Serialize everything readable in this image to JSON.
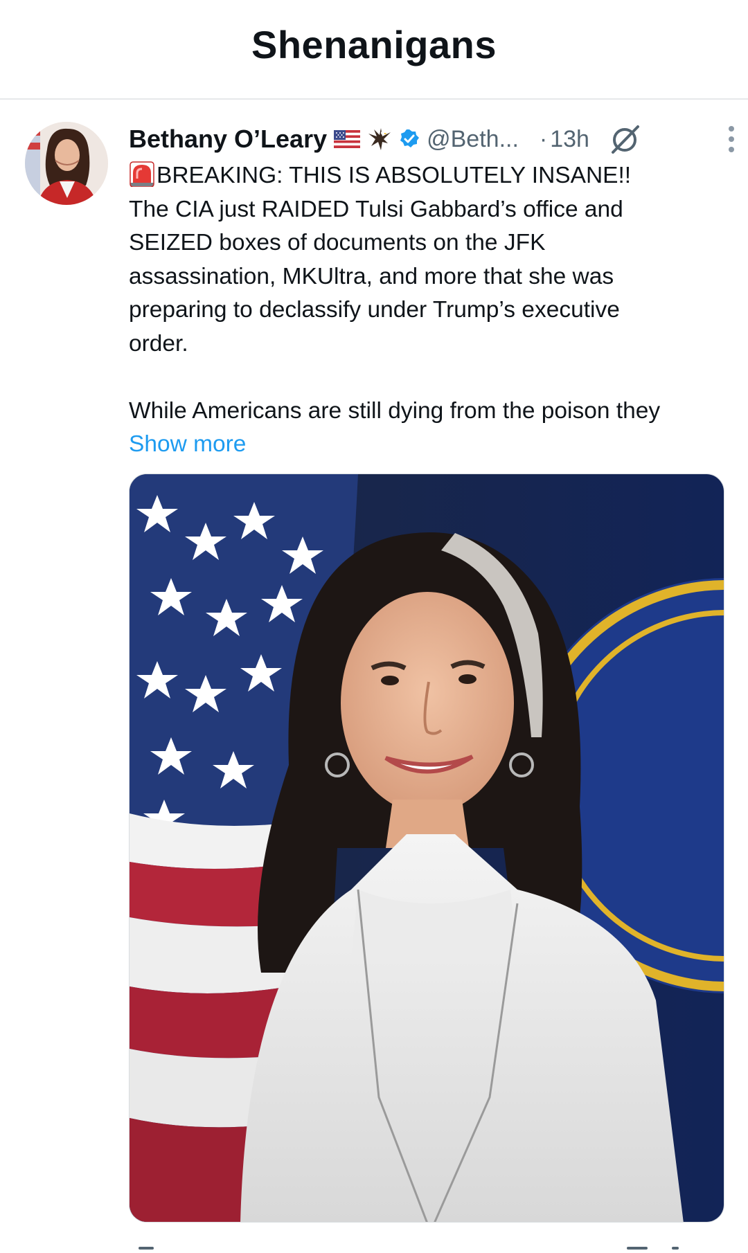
{
  "header": {
    "title": "Shenanigans"
  },
  "tweet": {
    "author": {
      "display_name": "Bethany O’Leary",
      "handle": "@Beth...",
      "verified": true,
      "emoji": [
        "flag-us-icon",
        "eagle-icon"
      ]
    },
    "separator": "·",
    "timestamp": "13h",
    "icons": {
      "grok": "grok-icon",
      "more": "more-vertical-icon",
      "siren": "siren-icon"
    },
    "text_lines": [
      "BREAKING: THIS IS ABSOLUTELY INSANE!!",
      "The CIA just RAIDED Tulsi Gabbard’s office and",
      "SEIZED boxes of documents on the JFK",
      "assassination, MKUltra, and more that she was",
      "preparing to declassify under Trump’s executive",
      "order.",
      "While Americans are still dying from the poison they"
    ],
    "show_more_label": "Show more"
  },
  "colors": {
    "link": "#1d9bf0",
    "secondary_text": "#536471",
    "verified": "#1d9bf0"
  }
}
